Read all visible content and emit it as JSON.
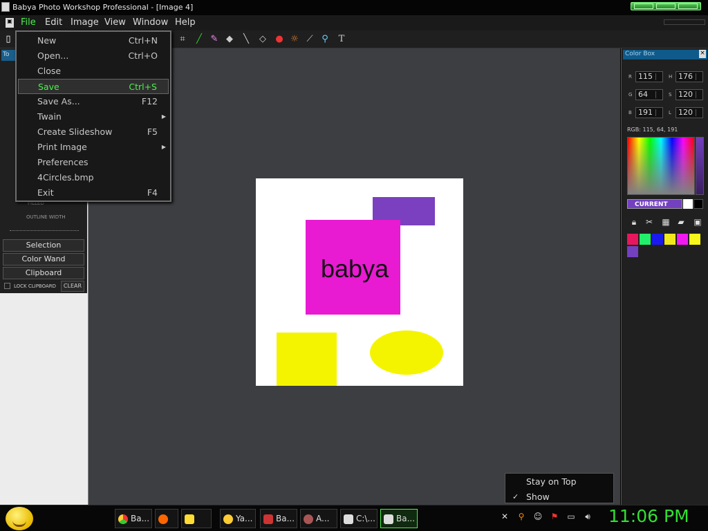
{
  "window": {
    "title": "Babya Photo Workshop Professional - [Image  4]"
  },
  "menubar": {
    "items": [
      "File",
      "Edit",
      "Image",
      "View",
      "Window",
      "Help"
    ]
  },
  "file_menu": {
    "items": [
      {
        "label": "New",
        "shortcut": "Ctrl+N"
      },
      {
        "label": "Open...",
        "shortcut": "Ctrl+O"
      },
      {
        "label": "Close",
        "shortcut": ""
      },
      {
        "label": "Save",
        "shortcut": "Ctrl+S",
        "highlighted": true
      },
      {
        "label": "Save As...",
        "shortcut": "F12"
      },
      {
        "label": "Twain",
        "shortcut": "",
        "submenu": true
      },
      {
        "label": "Create Slideshow",
        "shortcut": "F5"
      },
      {
        "label": "Print Image",
        "shortcut": "",
        "submenu": true
      },
      {
        "label": "Preferences",
        "shortcut": ""
      },
      {
        "label": "4Circles.bmp",
        "shortcut": ""
      },
      {
        "label": "Exit",
        "shortcut": "F4"
      }
    ]
  },
  "left_panel": {
    "filled_label": "FILLED",
    "outline_width_label": "OUTLINE WIDTH",
    "buttons": [
      "Selection",
      "Color Wand",
      "Clipboard"
    ],
    "lock_clipboard": "LOCK CLIPBOARD",
    "clear": "CLEAR"
  },
  "canvas": {
    "text": "babya"
  },
  "color_box": {
    "title": "Color Box",
    "r": {
      "label": "R",
      "value": "115"
    },
    "g": {
      "label": "G",
      "value": "64"
    },
    "b": {
      "label": "B",
      "value": "191"
    },
    "h": {
      "label": "H",
      "value": "176"
    },
    "s": {
      "label": "S",
      "value": "120"
    },
    "l": {
      "label": "L",
      "value": "120"
    },
    "rgb_text": "RGB: 115, 64, 191",
    "current_label": "CURRENT",
    "current_color": "#7340bf",
    "swatches": [
      "#e8175d",
      "#22f06a",
      "#1a1af0",
      "#f0e81a",
      "#f01af0",
      "#f8f81a",
      "#7340bf"
    ]
  },
  "tray_popup": {
    "items": [
      "Stay on Top",
      "Show"
    ],
    "checkmark": "✓"
  },
  "taskbar": {
    "buttons": [
      "Ba...",
      "",
      "",
      "Ya...",
      "Ba...",
      "A...",
      "C:\\...",
      "Ba..."
    ],
    "clock": "11:06 PM"
  }
}
